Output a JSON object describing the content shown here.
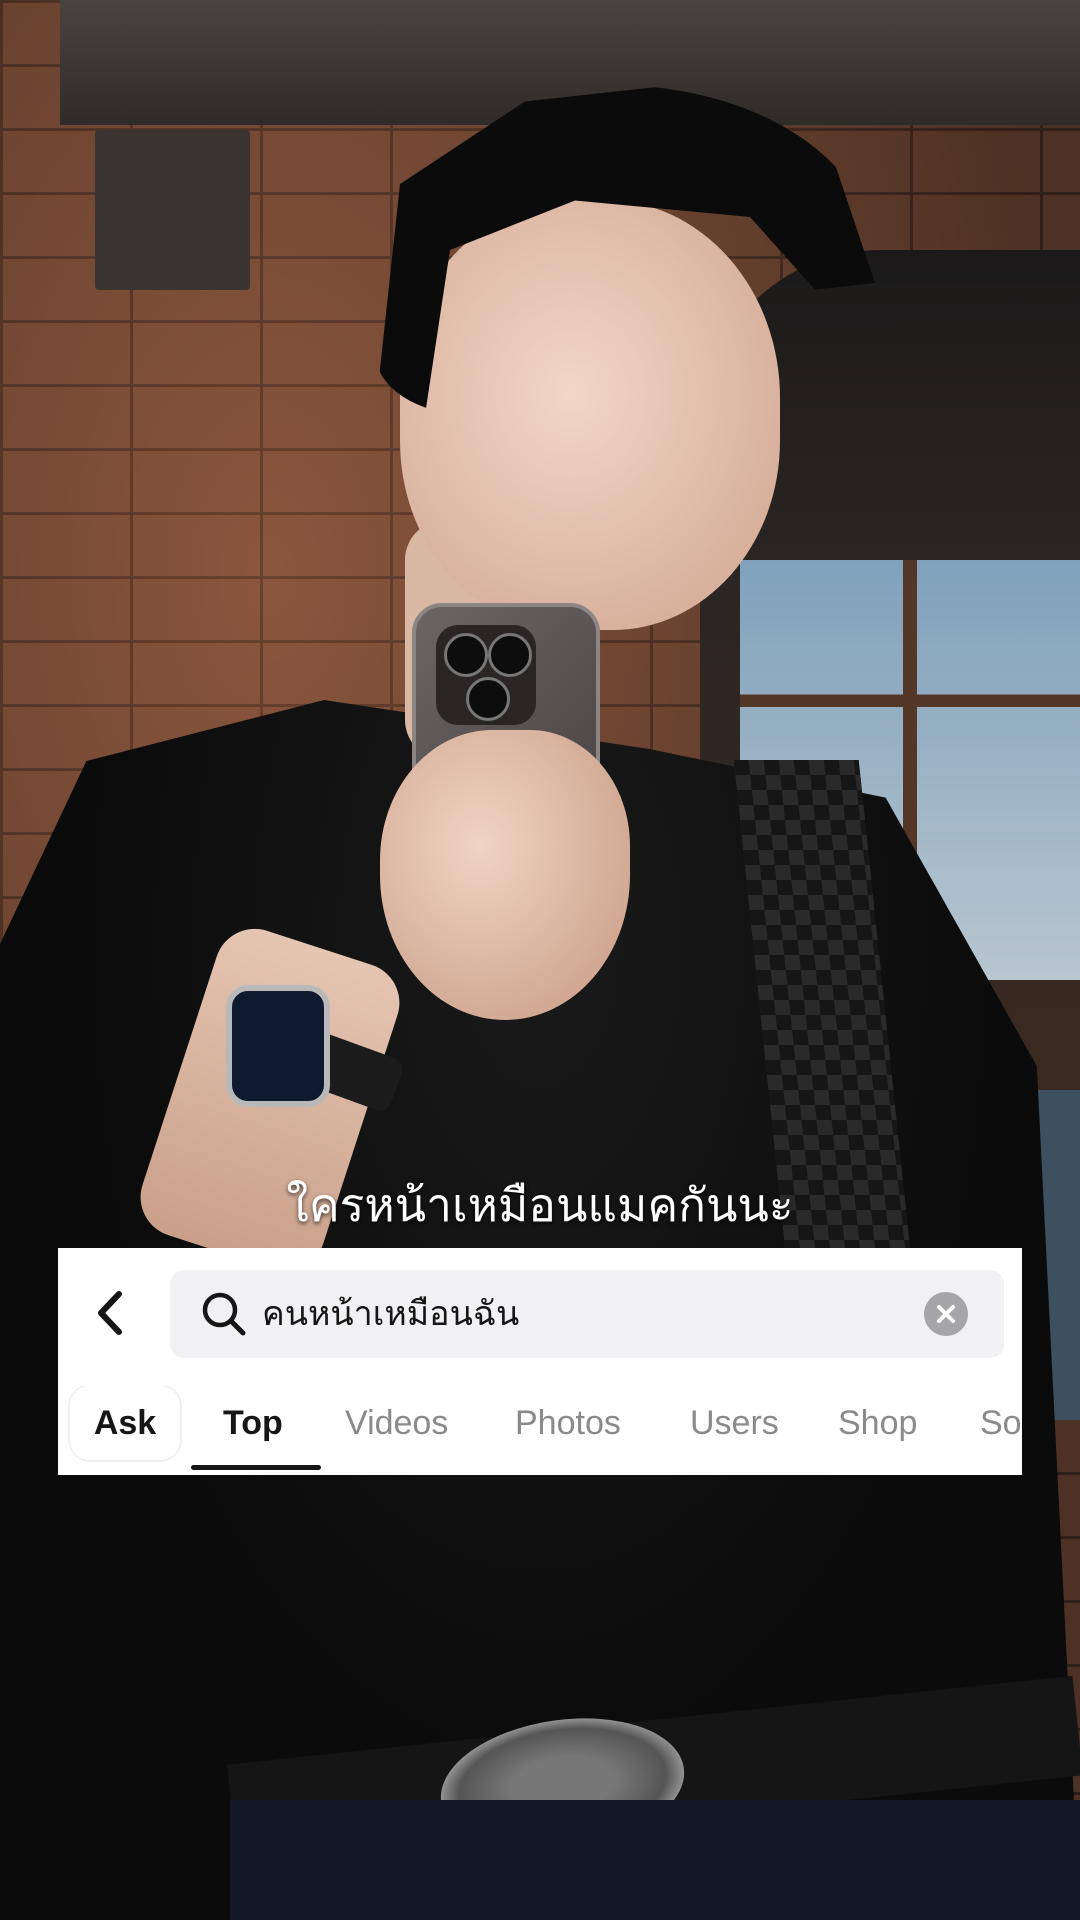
{
  "caption": "ใครหน้าเหมือนแมคกันนะ",
  "search": {
    "query": "คนหน้าเหมือนฉัน"
  },
  "icons": {
    "back": "chevron-left-icon",
    "search": "search-icon",
    "clear": "clear-x-icon"
  },
  "tabs": [
    {
      "label": "Ask",
      "active": false
    },
    {
      "label": "Top",
      "active": true
    },
    {
      "label": "Videos",
      "active": false
    },
    {
      "label": "Photos",
      "active": false
    },
    {
      "label": "Users",
      "active": false
    },
    {
      "label": "Shop",
      "active": false
    },
    {
      "label": "So",
      "active": false
    }
  ],
  "colors": {
    "panel_bg": "#ffffff",
    "search_field_bg": "#f1f1f3",
    "active_tab_text": "#161616",
    "inactive_tab_text": "#8a8a8e",
    "caption_text": "#ffffff"
  }
}
